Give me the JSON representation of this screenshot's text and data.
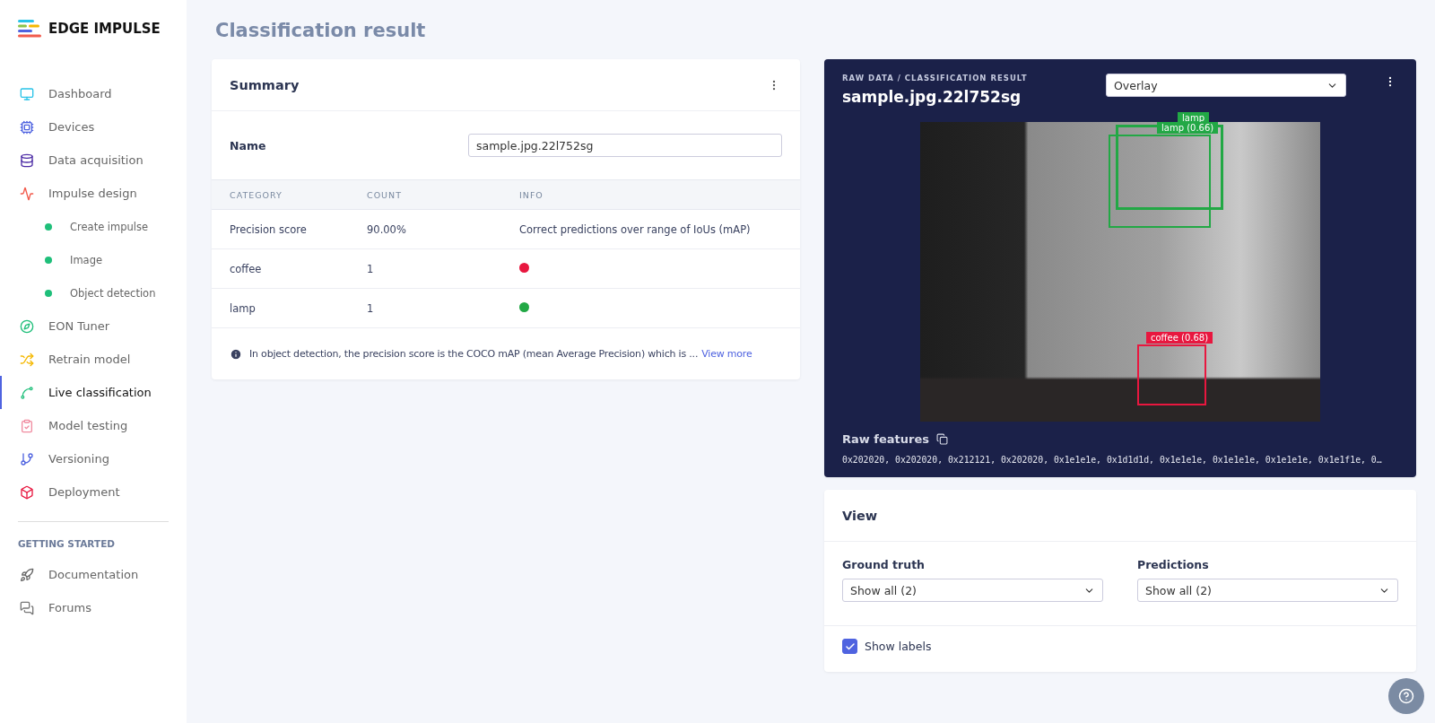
{
  "brand": "EDGE IMPULSE",
  "sidebar": {
    "items": [
      {
        "label": "Dashboard",
        "selected": false
      },
      {
        "label": "Devices",
        "selected": false
      },
      {
        "label": "Data acquisition",
        "selected": false
      },
      {
        "label": "Impulse design",
        "selected": false,
        "children": [
          {
            "label": "Create impulse",
            "selected": false
          },
          {
            "label": "Image",
            "selected": false
          },
          {
            "label": "Object detection",
            "selected": false
          }
        ]
      },
      {
        "label": "EON Tuner",
        "selected": false
      },
      {
        "label": "Retrain model",
        "selected": false
      },
      {
        "label": "Live classification",
        "selected": true
      },
      {
        "label": "Model testing",
        "selected": false
      },
      {
        "label": "Versioning",
        "selected": false
      },
      {
        "label": "Deployment",
        "selected": false
      }
    ],
    "section": "GETTING STARTED",
    "links": [
      {
        "label": "Documentation"
      },
      {
        "label": "Forums"
      }
    ]
  },
  "page_title": "Classification result",
  "summary": {
    "title": "Summary",
    "name_label": "Name",
    "name_value": "sample.jpg.22l752sg",
    "columns": [
      "CATEGORY",
      "COUNT",
      "INFO"
    ],
    "rows": [
      {
        "category": "Precision score",
        "count": "90.00%",
        "kind": "text",
        "info": "Correct predictions over range of IoUs (mAP)"
      },
      {
        "category": "coffee",
        "count": "1",
        "kind": "dot",
        "color": "#e8173f"
      },
      {
        "category": "lamp",
        "count": "1",
        "kind": "dot",
        "color": "#22a845"
      }
    ],
    "note": "In object detection, the precision score is the COCO mAP (mean Average Precision) which is ...",
    "note_link": "View more"
  },
  "result": {
    "breadcrumb": "RAW DATA / CLASSIFICATION RESULT",
    "title": "sample.jpg.22l752sg",
    "mode": "Overlay",
    "boxes": [
      {
        "label": "lamp",
        "kind": "ground_truth",
        "color": "#22a845"
      },
      {
        "label": "lamp (0.66)",
        "kind": "prediction",
        "color": "#22a845"
      },
      {
        "label": "coffee (0.68)",
        "kind": "prediction",
        "color": "#e8173f"
      }
    ],
    "features_label": "Raw features",
    "features": "0x202020, 0x202020, 0x212121, 0x202020, 0x1e1e1e, 0x1d1d1d, 0x1e1e1e, 0x1e1e1e, 0x1e1e1e, 0x1e1f1e, 0…"
  },
  "view": {
    "title": "View",
    "ground_truth_label": "Ground truth",
    "ground_truth": "Show all (2)",
    "predictions_label": "Predictions",
    "predictions": "Show all (2)",
    "show_labels": {
      "label": "Show labels",
      "checked": true
    }
  }
}
